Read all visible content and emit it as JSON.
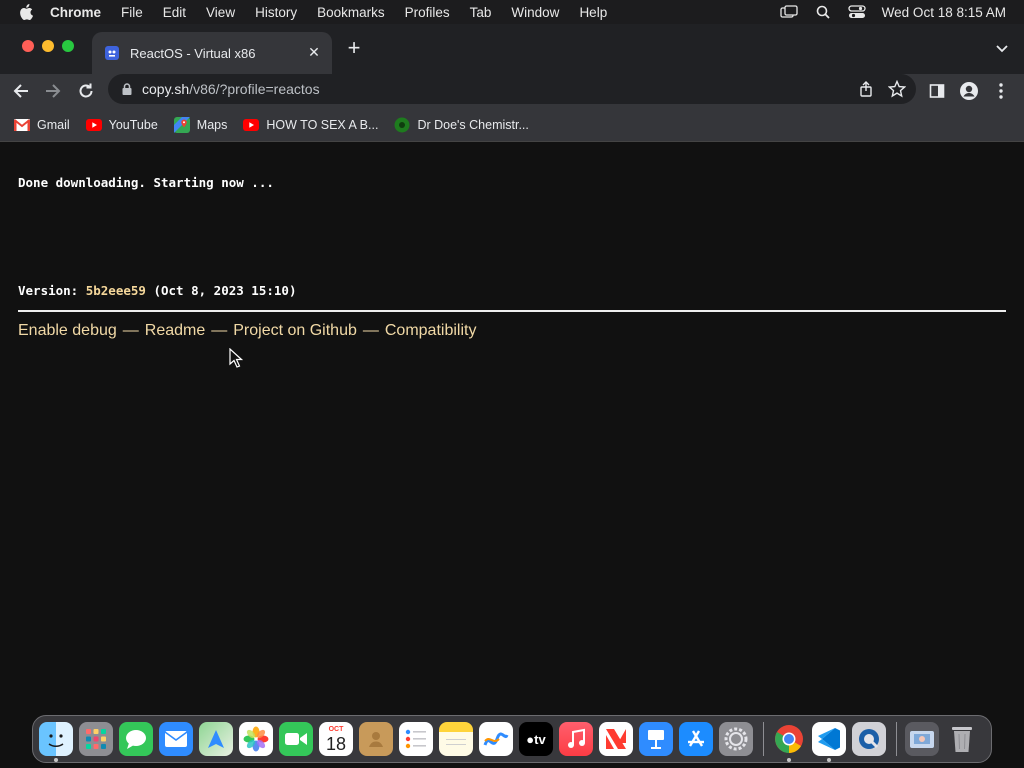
{
  "menubar": {
    "app_name": "Chrome",
    "items": [
      "File",
      "Edit",
      "View",
      "History",
      "Bookmarks",
      "Profiles",
      "Tab",
      "Window",
      "Help"
    ],
    "clock": "Wed Oct 18  8:15 AM"
  },
  "browser": {
    "tab_title": "ReactOS - Virtual x86",
    "url_host": "copy.sh",
    "url_path": "/v86/?profile=reactos",
    "bookmarks": [
      {
        "label": "Gmail",
        "icon": "gmail-icon"
      },
      {
        "label": "YouTube",
        "icon": "youtube-icon"
      },
      {
        "label": "Maps",
        "icon": "maps-icon"
      },
      {
        "label": "HOW TO SEX A B...",
        "icon": "youtube-icon"
      },
      {
        "label": "Dr Doe's Chemistr...",
        "icon": "site-favicon-icon"
      }
    ]
  },
  "page": {
    "status_text": "Done downloading. Starting now ...",
    "version_label": "Version: ",
    "version_hash": "5b2eee59",
    "version_date": " (Oct 8, 2023 15:10)",
    "links": {
      "enable_debug": "Enable debug",
      "readme": "Readme",
      "github": "Project on Github",
      "compatibility": "Compatibility",
      "separator": "—"
    }
  },
  "dock": {
    "apps": [
      "finder",
      "launchpad",
      "messages",
      "mail",
      "maps",
      "photos",
      "facetime",
      "calendar",
      "contacts",
      "reminders",
      "notes",
      "freeform",
      "tv",
      "music",
      "news",
      "keynote",
      "app-store",
      "system-settings",
      "chrome",
      "vscode",
      "quicktime",
      "downloads",
      "trash"
    ],
    "calendar_month": "OCT",
    "calendar_day": "18"
  },
  "colors": {
    "accent_link": "#f1d9a6",
    "version_hash": "#f5d79a",
    "page_background": "#111111"
  }
}
